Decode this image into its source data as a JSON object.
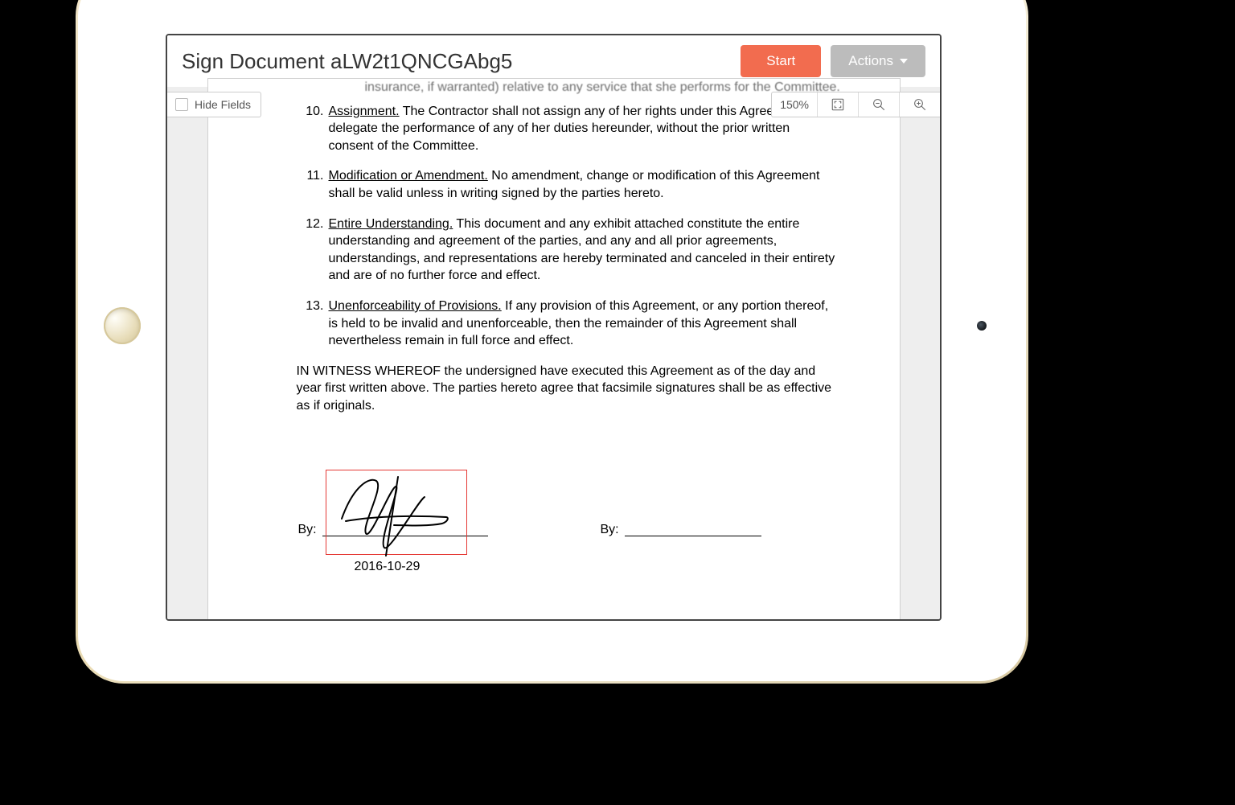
{
  "header": {
    "title": "Sign Document aLW2t1QNCGAbg5",
    "start_label": "Start",
    "actions_label": "Actions"
  },
  "toolbar": {
    "hide_fields_label": "Hide Fields",
    "zoom_level": "150%"
  },
  "document": {
    "cut_line": "insurance, if warranted) relative to any service that she performs for the Committee.",
    "clauses": [
      {
        "num": "10.",
        "title": "Assignment.",
        "text": "  The Contractor shall not assign any of her rights under this Agreement, or delegate the performance of any of her duties hereunder, without the prior written consent of the Committee."
      },
      {
        "num": "11.",
        "title": "Modification or Amendment.",
        "text": "  No amendment, change or modification of this Agreement shall be valid unless in writing signed by the parties hereto."
      },
      {
        "num": "12.",
        "title": "Entire Understanding.",
        "text": "  This document and any exhibit attached constitute the entire understanding and agreement of the parties, and any and all prior agreements, understandings, and representations are hereby terminated and canceled in their entirety and are of no further force and effect."
      },
      {
        "num": "13.",
        "title": "Unenforceability of Provisions.",
        "text": "  If any provision of this Agreement, or any portion thereof, is held to be invalid and unenforceable, then the remainder of this Agreement shall nevertheless remain in full force and effect."
      }
    ],
    "witness": "IN WITNESS WHEREOF the undersigned have executed this Agreement as of the day and year first written above.  The parties hereto agree that facsimile signatures shall be as effective as if originals.",
    "signature": {
      "by_label": "By:",
      "date": "2016-10-29"
    }
  }
}
